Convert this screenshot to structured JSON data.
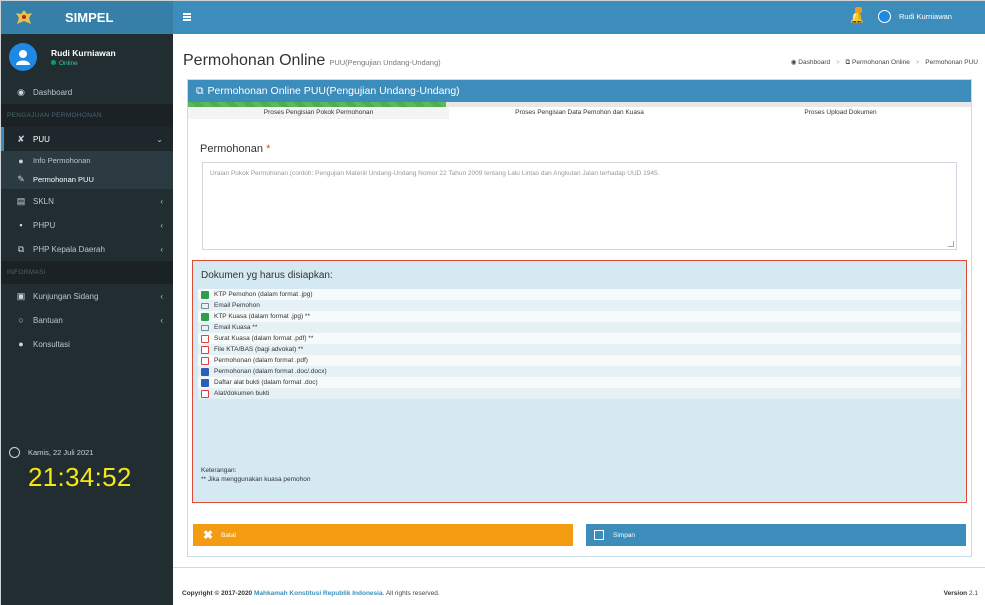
{
  "app": {
    "brand": "SIMPEL"
  },
  "user": {
    "name": "Rudi Kurniawan",
    "status": "Online"
  },
  "sidebar": {
    "dashboard": "Dashboard",
    "header_pengajuan": "PENGAJUAN PERMOHONAN",
    "puu": "PUU",
    "sub_info": "Info Permohonan",
    "sub_permohonan": "Permohonan PUU",
    "skln": "SKLN",
    "phpu": "PHPU",
    "php_kepala": "PHP Kepala Daerah",
    "header_informasi": "INFORMASI",
    "kunjungan": "Kunjungan Sidang",
    "bantuan": "Bantuan",
    "konsultasi": "Konsultasi"
  },
  "clock": {
    "date": "Kamis, 22 Juli 2021",
    "time": "21:34:52"
  },
  "topbar": {
    "username": "Rudi Kurniawan"
  },
  "page": {
    "title": "Permohonan Online",
    "subtitle": "PUU(Pengujian Undang-Undang)",
    "breadcrumb": [
      "Dashboard",
      "Permohonan Online",
      "Permohonan PUU"
    ]
  },
  "box": {
    "header": "Permohonan Online PUU(Pengujian Undang-Undang)",
    "progress": 0.33,
    "steps": [
      "Proses Pengisian Pokok Permohonan",
      "Proses Pengisian Data Pemohon dan Kuasa",
      "Proses Upload Dokumen"
    ]
  },
  "form": {
    "label": "Permohonan",
    "required_mark": "*",
    "placeholder": "Uraian Pokok Permohonan (contoh: Pengujian Materiil Undang-Undang Nomor 22 Tahun 2009 tentang Lalu Lintas dan Angkutan Jalan terhadap UUD 1945."
  },
  "documents": {
    "title": "Dokumen yg harus disiapkan:",
    "items": [
      {
        "label": "KTP Pemohon (dalam format .jpg)",
        "icon": "jpg"
      },
      {
        "label": "Email Pemohon",
        "icon": "mail"
      },
      {
        "label": "KTP Kuasa (dalam format .jpg) **",
        "icon": "jpg"
      },
      {
        "label": "Email Kuasa **",
        "icon": "mail"
      },
      {
        "label": "Surat Kuasa (dalam format .pdf) **",
        "icon": "pdf"
      },
      {
        "label": "File KTA/BAS (bagi advokat) **",
        "icon": "pdf"
      },
      {
        "label": "Permohonan (dalam format .pdf)",
        "icon": "pdf"
      },
      {
        "label": "Permohonan (dalam format .doc/.docx)",
        "icon": "doc"
      },
      {
        "label": "Daftar alat bukti (dalam format .doc)",
        "icon": "doc"
      },
      {
        "label": "Alat/dokumen bukti",
        "icon": "pdf"
      }
    ],
    "note_title": "Keterangan:",
    "note_text": "** Jika menggunakan kuasa pemohon"
  },
  "buttons": {
    "cancel": "Batal",
    "save": "Simpan"
  },
  "footer": {
    "copyright_prefix": "Copyright © 2017-2020",
    "org": "Mahkamah Konstitusi Republik Indonesia",
    "rights": ". All rights reserved.",
    "version_label": "Version",
    "version": "2.1"
  },
  "colors": {
    "primary": "#3c8dbc",
    "sidebar": "#222d32",
    "warning": "#f39c12",
    "danger": "#dd4b39",
    "clock": "#f5e616"
  }
}
